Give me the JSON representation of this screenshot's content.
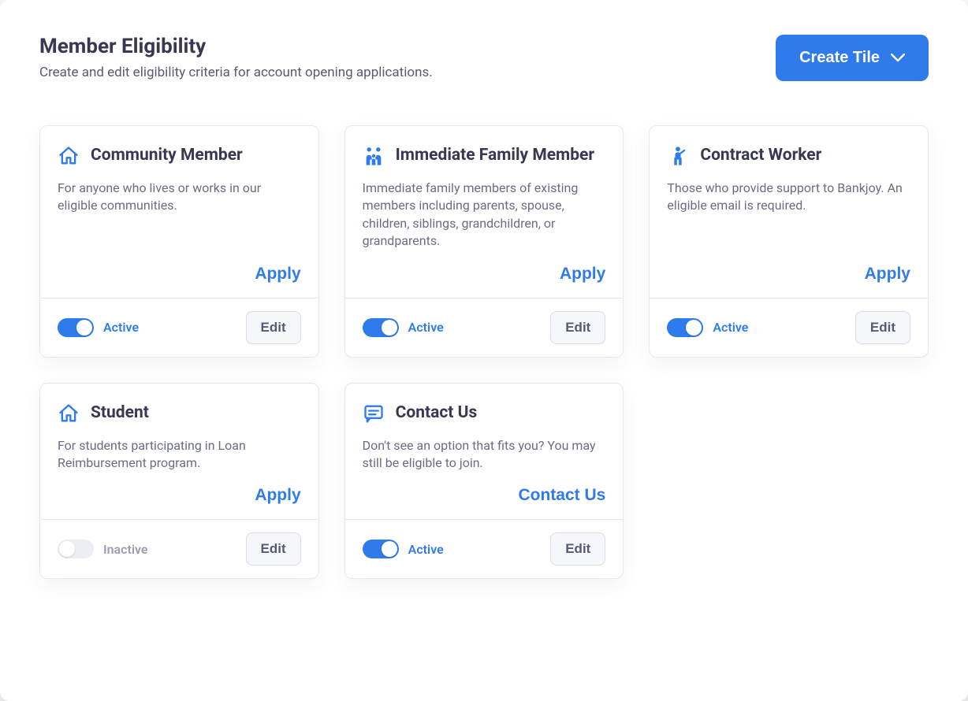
{
  "header": {
    "title": "Member Eligibility",
    "subtitle": "Create and edit eligibility criteria for account opening applications.",
    "create_button": "Create Tile"
  },
  "labels": {
    "active": "Active",
    "inactive": "Inactive",
    "edit": "Edit",
    "apply": "Apply",
    "contact_us": "Contact Us"
  },
  "tiles": [
    {
      "icon": "house-icon",
      "title": "Community Member",
      "description": "For anyone who lives or works in our eligible communities.",
      "action": "apply",
      "active": true
    },
    {
      "icon": "family-icon",
      "title": "Immediate Family Member",
      "description": "Immediate family members of existing members including parents, spouse, children, siblings, grandchildren, or grandparents.",
      "action": "apply",
      "active": true
    },
    {
      "icon": "person-icon",
      "title": "Contract Worker",
      "description": "Those who provide support to Bankjoy. An eligible email is required.",
      "action": "apply",
      "active": true
    },
    {
      "icon": "house-icon",
      "title": "Student",
      "description": "For students participating in Loan Reimbursement program.",
      "action": "apply",
      "active": false
    },
    {
      "icon": "chat-icon",
      "title": "Contact Us",
      "description": "Don't see an option that fits you? You may still be eligible to join.",
      "action": "contact_us",
      "active": true
    }
  ]
}
